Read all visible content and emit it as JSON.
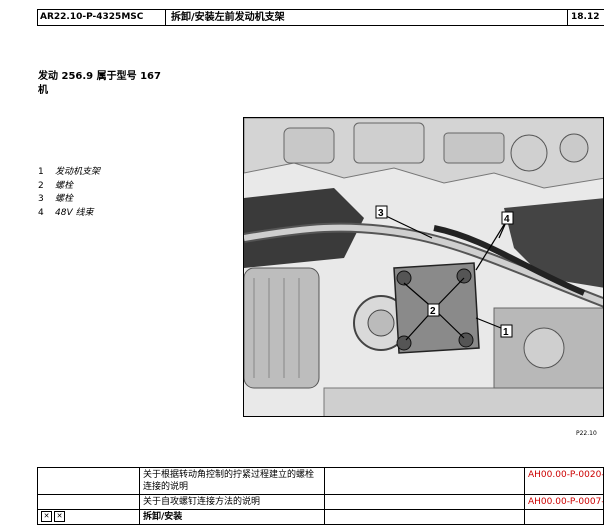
{
  "header": {
    "doc_id": "AR22.10-P-4325MSC",
    "title": "拆卸/安装左前发动机支架",
    "page_ref": "18.12"
  },
  "section_title": {
    "line1": "发动  256.9 属于型号 167",
    "line2": "机"
  },
  "legend": [
    {
      "num": "1",
      "label": "发动机支架"
    },
    {
      "num": "2",
      "label": "螺栓"
    },
    {
      "num": "3",
      "label": "螺栓"
    },
    {
      "num": "4",
      "label": "48V 线束"
    }
  ],
  "figure": {
    "callouts": [
      "3",
      "4",
      "2",
      "1"
    ],
    "ref": "P22.10"
  },
  "refs_table": {
    "rows": [
      {
        "text": "关于根据转动角控制的拧紧过程建立的螺栓连接的说明",
        "ref": "AH00.00-P-0020-"
      },
      {
        "text": "关于自攻螺钉连接方法的说明",
        "ref": "AH00.00-P-0007-"
      }
    ],
    "footer_label": "拆卸/安装",
    "icon1": "✕",
    "icon2": "✕"
  }
}
